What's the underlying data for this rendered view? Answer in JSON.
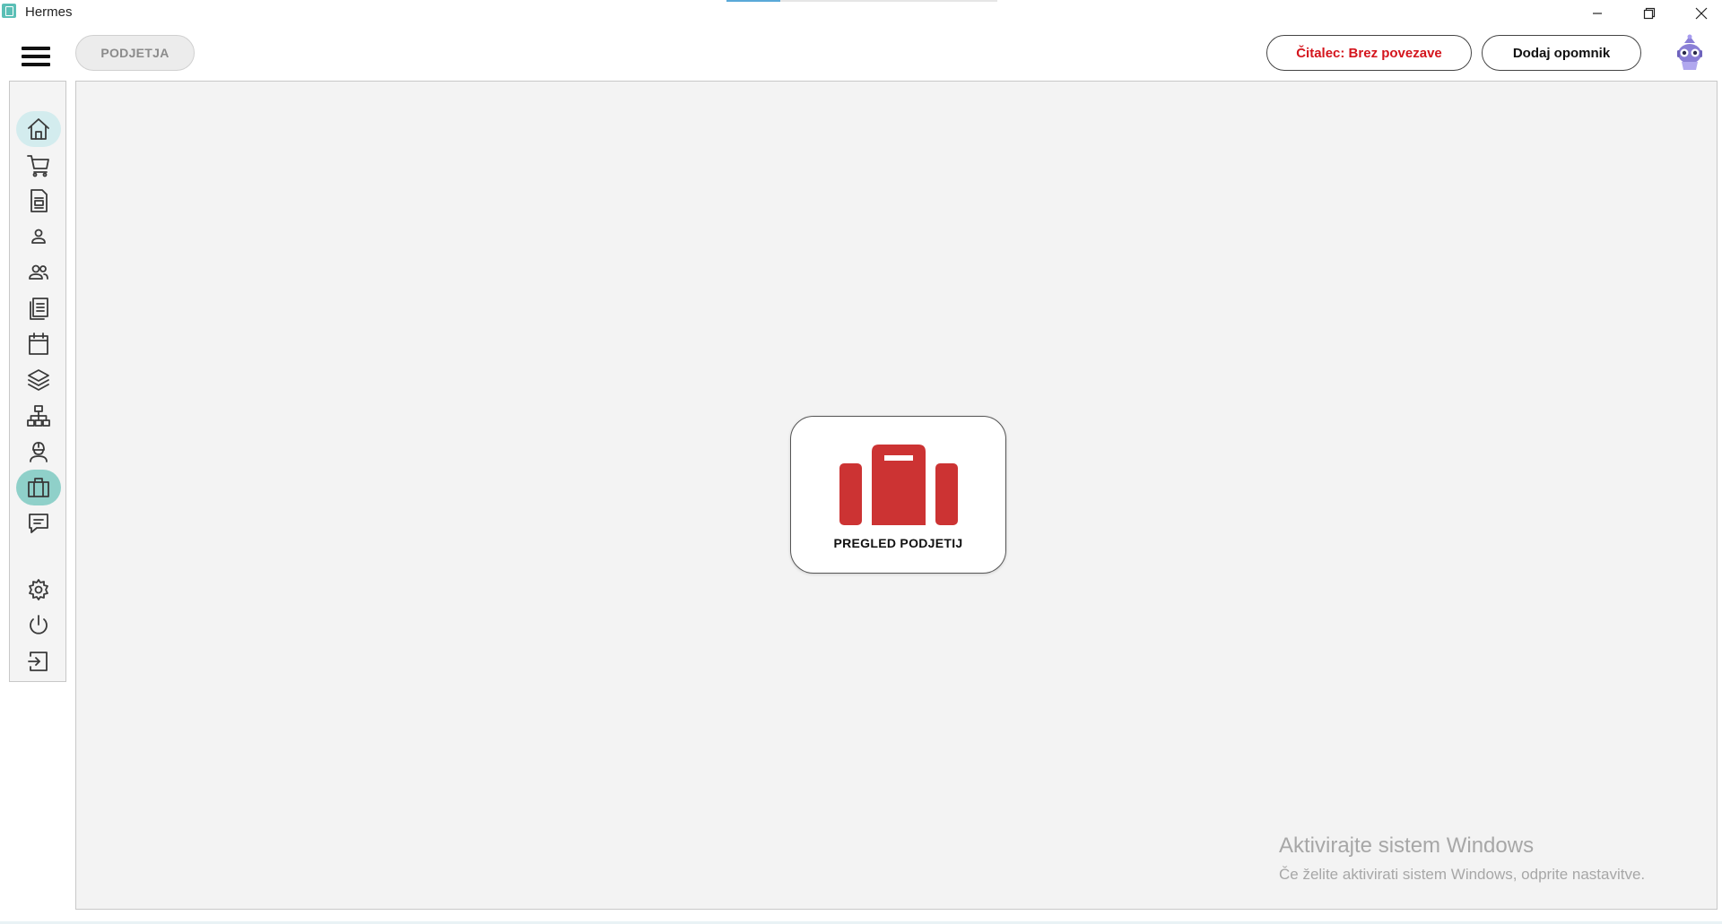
{
  "window": {
    "title": "Hermes",
    "minimize_icon": "minimize-icon",
    "restore_icon": "restore-icon",
    "close_icon": "close-icon",
    "progress": 0.2
  },
  "toolbar": {
    "breadcrumb": "PODJETJA",
    "reader_status": "Čitalec: Brez povezave",
    "add_reminder": "Dodaj opomnik",
    "colors": {
      "reader_status": "#d4151d",
      "accent": "#8fd0c9",
      "tile_icon": "#cc3333"
    }
  },
  "sidebar": {
    "items": [
      {
        "icon": "home-icon",
        "active": "home"
      },
      {
        "icon": "shopping-cart-icon"
      },
      {
        "icon": "document-icon"
      },
      {
        "icon": "person-icon"
      },
      {
        "icon": "people-icon"
      },
      {
        "icon": "documents-list-icon"
      },
      {
        "icon": "calendar-icon"
      },
      {
        "icon": "layers-icon"
      },
      {
        "icon": "network-icon"
      },
      {
        "icon": "worker-icon"
      },
      {
        "icon": "briefcase-icon",
        "active": "current"
      },
      {
        "icon": "chat-icon"
      },
      {
        "icon": "gear-icon"
      },
      {
        "icon": "power-icon"
      },
      {
        "icon": "logout-icon"
      }
    ]
  },
  "main": {
    "tile": {
      "label": "PREGLED PODJETIJ",
      "icon": "briefcase-icon"
    }
  },
  "watermark": {
    "title": "Aktivirajte sistem Windows",
    "subtitle": "Če želite aktivirati sistem Windows, odprite nastavitve."
  }
}
